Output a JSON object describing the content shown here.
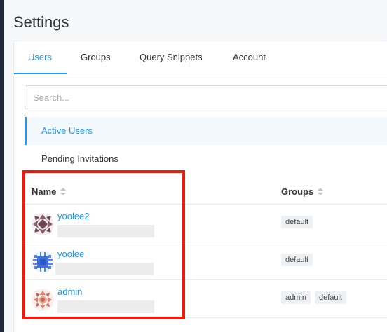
{
  "page": {
    "title": "Settings"
  },
  "tabs": [
    {
      "label": "Users",
      "active": true
    },
    {
      "label": "Groups",
      "active": false
    },
    {
      "label": "Query Snippets",
      "active": false
    },
    {
      "label": "Account",
      "active": false
    }
  ],
  "search": {
    "placeholder": "Search..."
  },
  "filters": {
    "active_users": "Active Users",
    "pending_invitations": "Pending Invitations"
  },
  "table": {
    "columns": {
      "name": "Name",
      "groups": "Groups"
    },
    "rows": [
      {
        "name": "yoolee2",
        "email": "",
        "groups": [
          "default"
        ],
        "avatar": "identicon-purple"
      },
      {
        "name": "yoolee",
        "email": "",
        "groups": [
          "default"
        ],
        "avatar": "identicon-blue"
      },
      {
        "name": "admin",
        "email": "",
        "groups": [
          "admin",
          "default"
        ],
        "avatar": "identicon-salmon"
      }
    ]
  },
  "colors": {
    "accent": "#2196f3",
    "highlight": "#ee1b0e"
  }
}
